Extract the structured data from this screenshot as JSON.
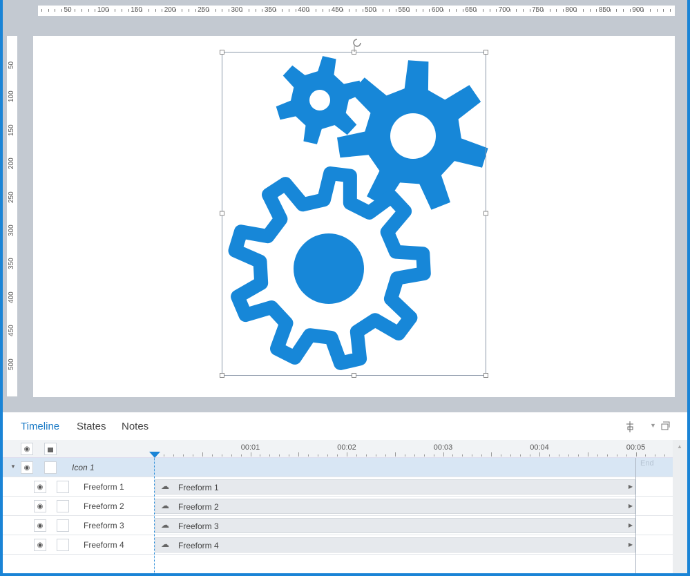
{
  "rulers": {
    "top": [
      "50",
      "100",
      "150",
      "200",
      "250",
      "300",
      "350",
      "400",
      "450",
      "500",
      "550",
      "600",
      "650",
      "700",
      "750",
      "800",
      "850",
      "900"
    ],
    "left": [
      "50",
      "100",
      "150",
      "200",
      "250",
      "300",
      "350",
      "400",
      "450",
      "500"
    ]
  },
  "tabs": [
    {
      "label": "Timeline"
    },
    {
      "label": "States"
    },
    {
      "label": "Notes"
    }
  ],
  "timeline": {
    "time_labels": [
      "00:01",
      "00:02",
      "00:03",
      "00:04",
      "00:05"
    ],
    "end_label": "End",
    "group": {
      "label": "Icon 1"
    },
    "layers": [
      {
        "label": "Freeform 1",
        "bar": "Freeform 1"
      },
      {
        "label": "Freeform 2",
        "bar": "Freeform 2"
      },
      {
        "label": "Freeform 3",
        "bar": "Freeform 3"
      },
      {
        "label": "Freeform 4",
        "bar": "Freeform 4"
      }
    ]
  },
  "colors": {
    "accent": "#1a84d6",
    "gear": "#1787d8"
  }
}
